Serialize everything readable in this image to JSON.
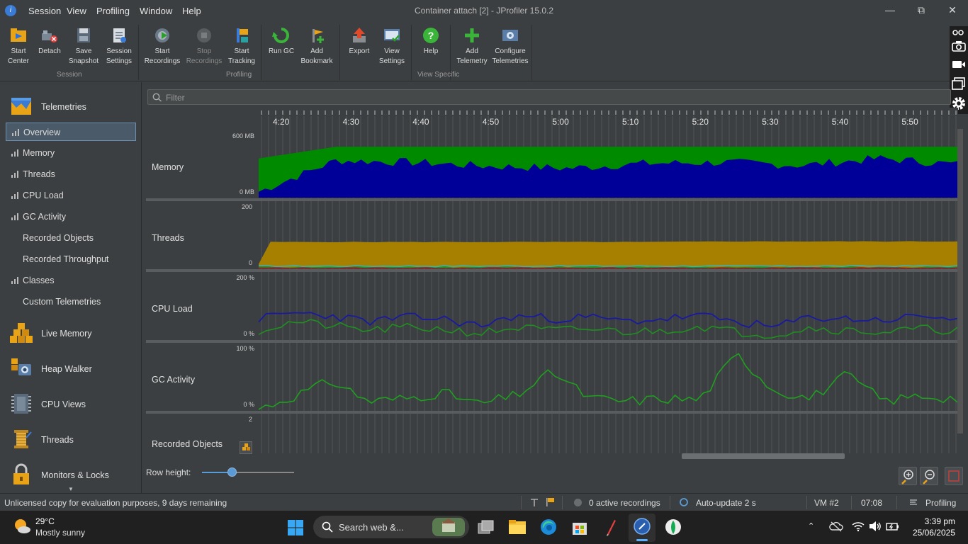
{
  "window": {
    "title": "Container attach [2] - JProfiler 15.0.2",
    "menu": [
      "Session",
      "View",
      "Profiling",
      "Window",
      "Help"
    ]
  },
  "toolbar": {
    "session": {
      "group_label": "Session",
      "buttons": [
        {
          "label1": "Start",
          "label2": "Center"
        },
        {
          "label1": "Detach",
          "label2": ""
        },
        {
          "label1": "Save",
          "label2": "Snapshot"
        },
        {
          "label1": "Session",
          "label2": "Settings"
        }
      ]
    },
    "profiling": {
      "group_label": "Profiling",
      "buttons": [
        {
          "label1": "Start",
          "label2": "Recordings"
        },
        {
          "label1": "Stop",
          "label2": "Recordings"
        },
        {
          "label1": "Start",
          "label2": "Tracking"
        },
        {
          "label1": "Run GC",
          "label2": ""
        },
        {
          "label1": "Add",
          "label2": "Bookmark"
        }
      ]
    },
    "view_specific": {
      "group_label": "View Specific",
      "buttons": [
        {
          "label1": "Export",
          "label2": ""
        },
        {
          "label1": "View",
          "label2": "Settings"
        },
        {
          "label1": "Help",
          "label2": ""
        },
        {
          "label1": "Add",
          "label2": "Telemetry"
        },
        {
          "label1": "Configure",
          "label2": "Telemetries"
        }
      ]
    }
  },
  "sidebar": {
    "telemetries_label": "Telemetries",
    "sub_items": [
      "Overview",
      "Memory",
      "Threads",
      "CPU Load",
      "GC Activity",
      "Recorded Objects",
      "Recorded Throughput",
      "Classes",
      "Custom Telemetries"
    ],
    "sections": [
      "Live Memory",
      "Heap Walker",
      "CPU Views",
      "Threads",
      "Monitors & Locks"
    ]
  },
  "filter": {
    "placeholder": "Filter"
  },
  "chart_data": [
    {
      "type": "area",
      "title": "Memory",
      "x": [
        "4:20",
        "4:30",
        "4:40",
        "4:50",
        "5:00",
        "5:10",
        "5:20",
        "5:30",
        "5:40",
        "5:50"
      ],
      "ytick_top": "600 MB",
      "ytick_bottom": "0 MB",
      "ylim": [
        0,
        600
      ],
      "series": [
        {
          "color": "#008a00",
          "values": [
            400,
            520,
            520,
            520,
            520,
            520,
            520,
            520,
            520,
            520
          ]
        },
        {
          "color": "#000099",
          "values": [
            60,
            380,
            360,
            320,
            300,
            350,
            360,
            330,
            400,
            340
          ]
        }
      ]
    },
    {
      "type": "area",
      "title": "Threads",
      "ytick_top": "200",
      "ytick_bottom": "0",
      "ylim": [
        0,
        200
      ],
      "series": [
        {
          "color": "#a88000",
          "values": [
            90,
            90,
            90,
            90,
            90,
            90,
            92,
            92,
            92,
            92
          ]
        }
      ]
    },
    {
      "type": "line",
      "title": "CPU Load",
      "ytick_top": "200 %",
      "ytick_bottom": "0 %",
      "ylim": [
        0,
        200
      ],
      "series": [
        {
          "color": "#1a1aa0",
          "values": [
            70,
            90,
            80,
            60,
            75,
            70,
            45,
            80,
            70,
            75,
            60,
            70,
            80,
            60,
            40,
            75,
            70,
            65,
            80,
            70
          ]
        },
        {
          "color": "#1f8f1f",
          "values": [
            30,
            60,
            45,
            30,
            40,
            35,
            20,
            40,
            30,
            35,
            25,
            30,
            45,
            25,
            15,
            40,
            30,
            25,
            35,
            30
          ]
        }
      ]
    },
    {
      "type": "line",
      "title": "GC Activity",
      "ytick_top": "100 %",
      "ytick_bottom": "0 %",
      "ylim": [
        0,
        100
      ],
      "series": [
        {
          "color": "#1f9f1f",
          "values": [
            2,
            25,
            50,
            15,
            20,
            30,
            10,
            25,
            65,
            20,
            15,
            20,
            18,
            95,
            35,
            20,
            60,
            15,
            25,
            20
          ]
        }
      ]
    },
    {
      "type": "line",
      "title": "Recorded Objects",
      "ytick_top": "2",
      "ylim": [
        0,
        2
      ],
      "series": []
    }
  ],
  "bottom": {
    "row_height_label": "Row height:",
    "row_height_value": 0.33
  },
  "status": {
    "license": "Unlicensed copy for evaluation purposes, 9 days remaining",
    "recordings": "0 active recordings",
    "autoupdate": "Auto-update 2 s",
    "vm": "VM #2",
    "time": "07:08",
    "mode": "Profiling"
  },
  "taskbar": {
    "weather_temp": "29°C",
    "weather_desc": "Mostly sunny",
    "search_placeholder": "Search web &...",
    "clock_time": "3:39 pm",
    "clock_date": "25/06/2025"
  }
}
